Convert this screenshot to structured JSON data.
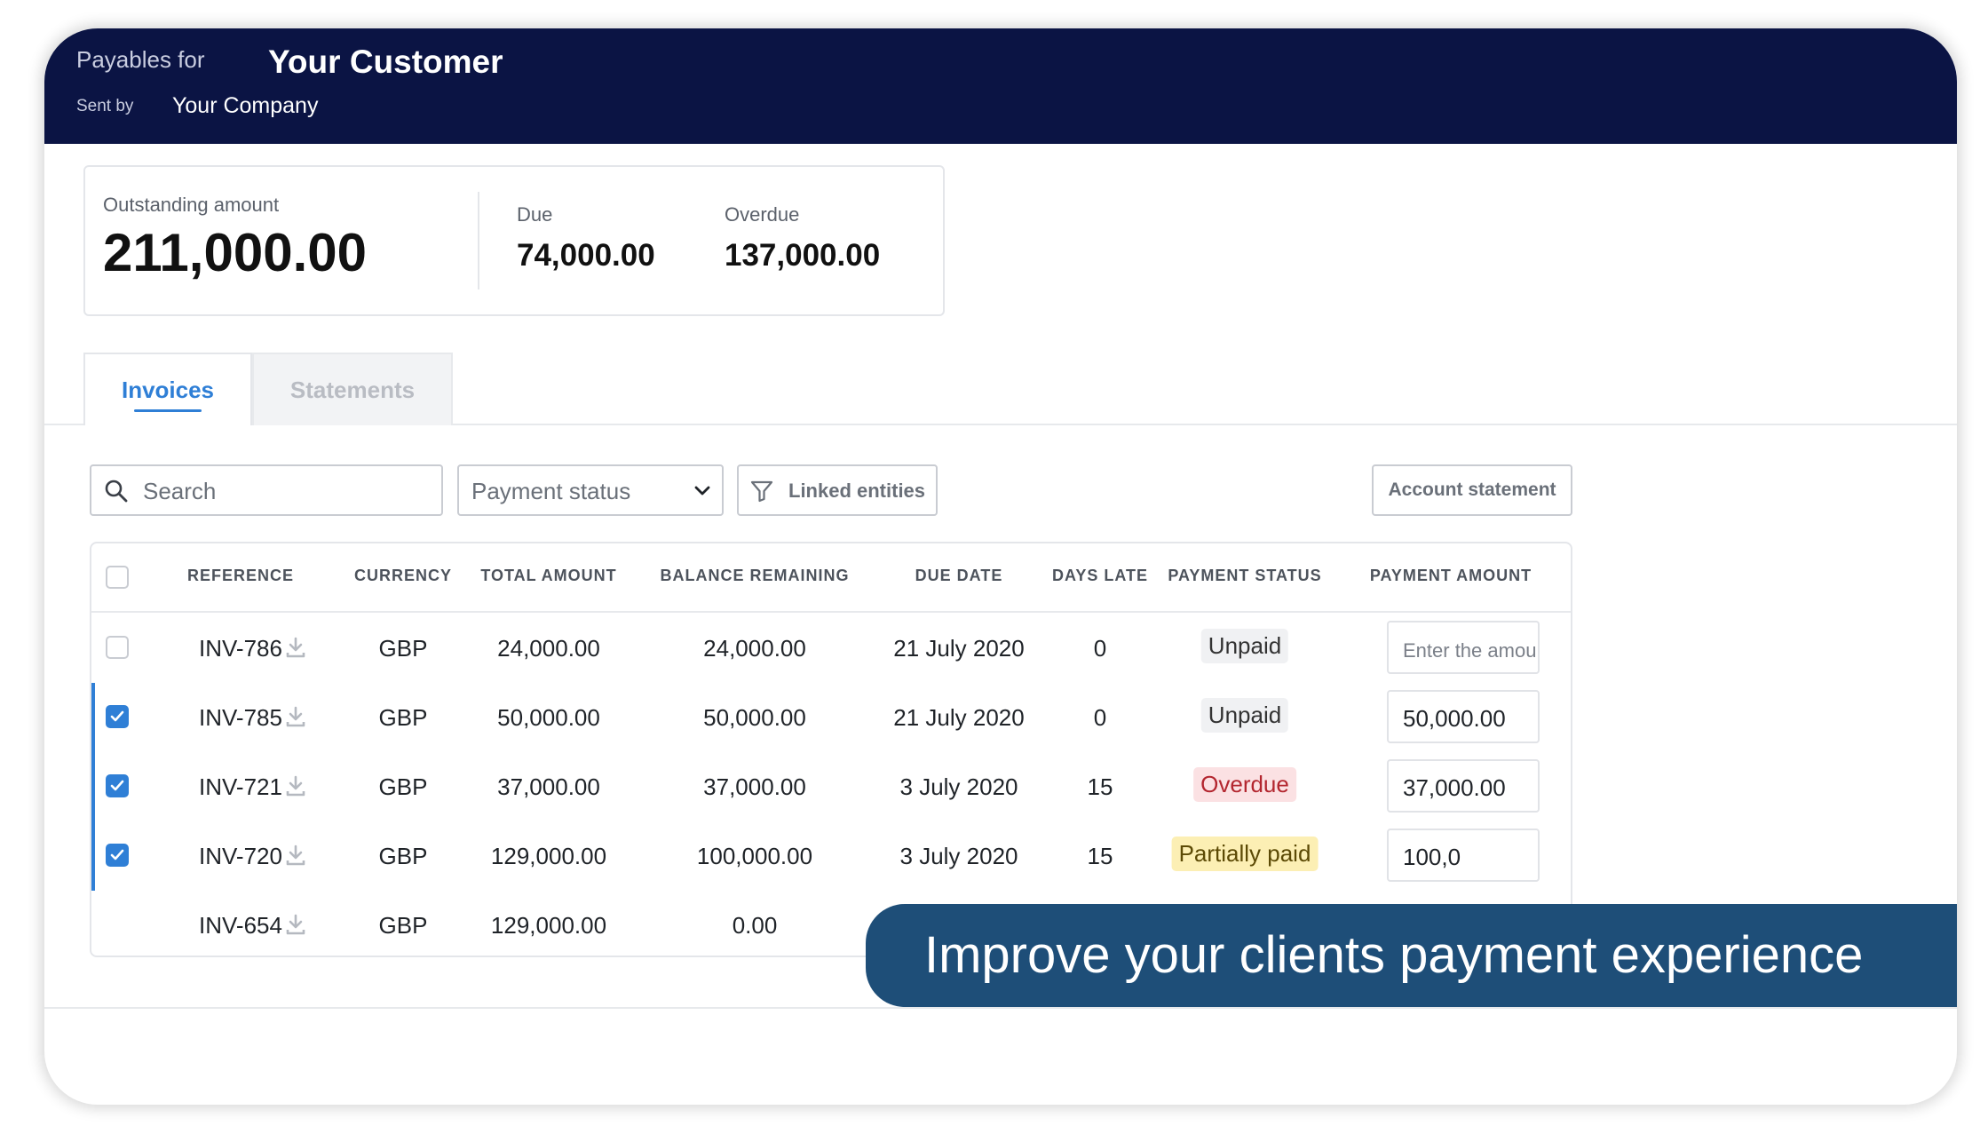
{
  "header": {
    "payables_for": "Payables for",
    "customer_name": "Your Customer",
    "sent_by": "Sent by",
    "company_name": "Your Company"
  },
  "summary": {
    "outstanding_label": "Outstanding amount",
    "outstanding_value": "211,000.00",
    "due_label": "Due",
    "due_value": "74,000.00",
    "overdue_label": "Overdue",
    "overdue_value": "137,000.00"
  },
  "tabs": [
    {
      "label": "Invoices",
      "active": true
    },
    {
      "label": "Statements",
      "active": false
    }
  ],
  "toolbar": {
    "search_placeholder": "Search",
    "payment_status_label": "Payment status",
    "linked_entities_label": "Linked entities",
    "account_statement_label": "Account statement"
  },
  "table": {
    "columns": [
      "REFERENCE",
      "CURRENCY",
      "TOTAL AMOUNT",
      "BALANCE REMAINING",
      "DUE DATE",
      "DAYS LATE",
      "PAYMENT STATUS",
      "PAYMENT AMOUNT"
    ],
    "rows": [
      {
        "checked": false,
        "reference": "INV-786",
        "currency": "GBP",
        "total": "24,000.00",
        "balance": "24,000.00",
        "due_date": "21 July 2020",
        "days_late": "0",
        "status": "Unpaid",
        "status_kind": "unpaid",
        "payment_amount": "",
        "payment_placeholder": "Enter the amount"
      },
      {
        "checked": true,
        "reference": "INV-785",
        "currency": "GBP",
        "total": "50,000.00",
        "balance": "50,000.00",
        "due_date": "21 July 2020",
        "days_late": "0",
        "status": "Unpaid",
        "status_kind": "unpaid",
        "payment_amount": "50,000.00",
        "payment_placeholder": ""
      },
      {
        "checked": true,
        "reference": "INV-721",
        "currency": "GBP",
        "total": "37,000.00",
        "balance": "37,000.00",
        "due_date": "3 July 2020",
        "days_late": "15",
        "status": "Overdue",
        "status_kind": "overdue",
        "payment_amount": "37,000.00",
        "payment_placeholder": ""
      },
      {
        "checked": true,
        "reference": "INV-720",
        "currency": "GBP",
        "total": "129,000.00",
        "balance": "100,000.00",
        "due_date": "3 July 2020",
        "days_late": "15",
        "status": "Partially paid",
        "status_kind": "partial",
        "payment_amount": "100,0",
        "payment_placeholder": ""
      },
      {
        "checked": null,
        "reference": "INV-654",
        "currency": "GBP",
        "total": "129,000.00",
        "balance": "0.00",
        "due_date": "",
        "days_late": "",
        "status": "",
        "status_kind": "",
        "payment_amount": "",
        "payment_placeholder": ""
      }
    ]
  },
  "banner": {
    "text": "Improve your clients payment experience"
  },
  "colors": {
    "header_bg": "#0b1444",
    "accent": "#2f7fd6",
    "banner_bg": "#1e4e78",
    "overdue_badge_bg": "#fbe1e3",
    "partial_badge_bg": "#fcefb4"
  }
}
